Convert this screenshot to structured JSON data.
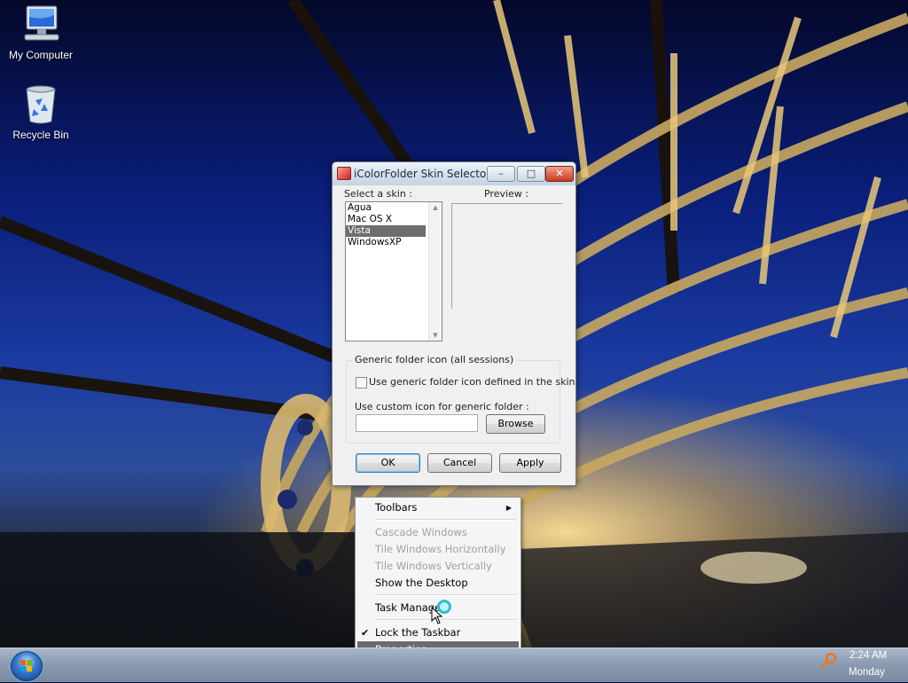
{
  "desktop": {
    "icons": [
      {
        "label": "My Computer",
        "icon": "computer-icon"
      },
      {
        "label": "Recycle Bin",
        "icon": "recycle-bin-icon"
      }
    ]
  },
  "dialog": {
    "title": "iColorFolder Skin Selector",
    "caption_buttons": {
      "minimize": "–",
      "maximize": "□",
      "close": "✕"
    },
    "select_skin_label": "Select a skin :",
    "preview_label": "Preview :",
    "skins": [
      "Agua",
      "Mac OS X",
      "Vista",
      "WindowsXP"
    ],
    "selected_skin": "Vista",
    "generic_group": {
      "legend": "Generic folder icon (all sessions)",
      "checkbox_label": "Use generic folder icon defined in the skin",
      "checkbox_checked": false,
      "custom_label": "Use custom icon for generic folder :",
      "custom_value": "",
      "browse_label": "Browse"
    },
    "buttons": {
      "ok": "OK",
      "cancel": "Cancel",
      "apply": "Apply"
    }
  },
  "context_menu": {
    "items": {
      "toolbars": "Toolbars",
      "cascade": "Cascade Windows",
      "tile_h": "Tile Windows Horizontally",
      "tile_v": "Tile Windows Vertically",
      "show_desktop": "Show the Desktop",
      "task_manager": "Task Manager",
      "lock_taskbar": "Lock the Taskbar",
      "properties": "Properties"
    },
    "lock_taskbar_checked": true,
    "highlighted": "Properties"
  },
  "taskbar": {
    "clock_time": "2:24 AM",
    "clock_day": "Monday"
  },
  "colors": {
    "menu_highlight": "#6b6b6b",
    "list_selection": "#6e6e6e",
    "taskbar": "#8c9cb2"
  }
}
